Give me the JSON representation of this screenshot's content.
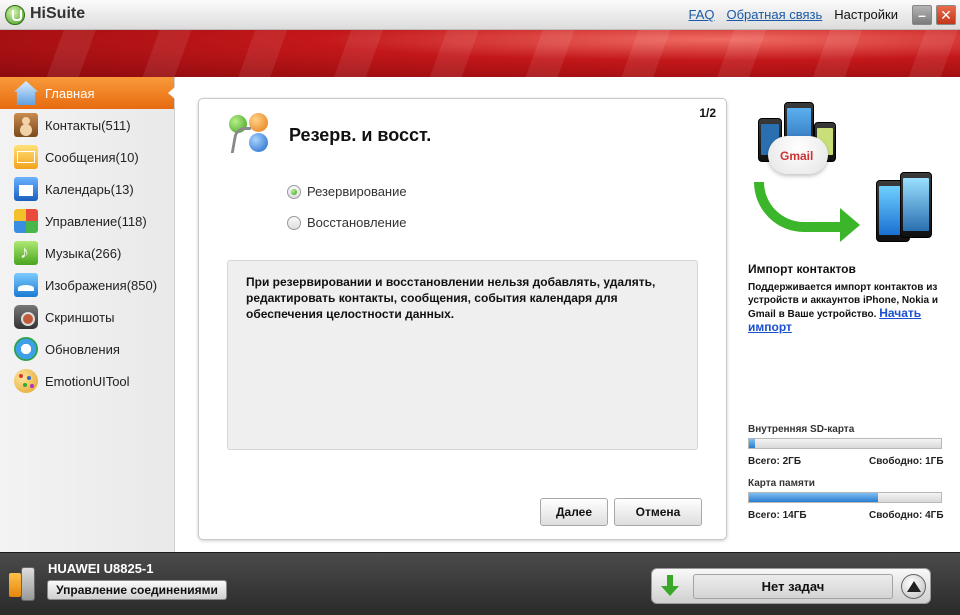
{
  "app": {
    "title": "HiSuite",
    "logo_icon": "hisuite-logo-icon"
  },
  "titlebar": {
    "links": [
      {
        "label": "FAQ"
      },
      {
        "label": "Обратная связь"
      }
    ],
    "settings": "Настройки"
  },
  "sidebar": {
    "items": [
      {
        "label": "Главная",
        "icon": "home-icon",
        "active": true
      },
      {
        "label": "Контакты(511)",
        "icon": "contacts-icon"
      },
      {
        "label": "Сообщения(10)",
        "icon": "messages-icon"
      },
      {
        "label": "Календарь(13)",
        "icon": "calendar-icon"
      },
      {
        "label": "Управление(118)",
        "icon": "apps-icon"
      },
      {
        "label": "Музыка(266)",
        "icon": "music-icon"
      },
      {
        "label": "Изображения(850)",
        "icon": "images-icon"
      },
      {
        "label": "Скриншоты",
        "icon": "camera-icon"
      },
      {
        "label": "Обновления",
        "icon": "update-icon"
      },
      {
        "label": "EmotionUITool",
        "icon": "palette-icon"
      }
    ]
  },
  "wizard": {
    "page": "1/2",
    "title": "Резерв. и восст.",
    "options": [
      {
        "label": "Резервирование",
        "checked": true
      },
      {
        "label": "Восстановление",
        "checked": false
      }
    ],
    "info": "При резервировании и восстановлении нельзя добавлять, удалять, редактировать контакты, сообщения, события календаря для обеспечения целостности данных.",
    "next": "Далее",
    "cancel": "Отмена"
  },
  "promo": {
    "title": "Импорт контактов",
    "text": "Поддерживается импорт контактов из устройств и аккаунтов iPhone, Nokia и Gmail в Ваше устройство.",
    "link": "Начать импорт",
    "gmail_label": "Gmail"
  },
  "storage": {
    "internal": {
      "label": "Внутренняя SD-карта",
      "total": "Всего: 2ГБ",
      "free": "Свободно: 1ГБ",
      "used_fraction": 0.03
    },
    "card": {
      "label": "Карта памяти",
      "total": "Всего: 14ГБ",
      "free": "Свободно: 4ГБ",
      "used_fraction": 0.67
    }
  },
  "device": {
    "name": "HUAWEI U8825-1",
    "connection_button": "Управление соединениями"
  },
  "tasks": {
    "label": "Нет задач"
  },
  "colors": {
    "accent": "#e76b10",
    "banner": "#c3171a",
    "link": "#1a5aa8",
    "progress": "#2a7ccf"
  }
}
